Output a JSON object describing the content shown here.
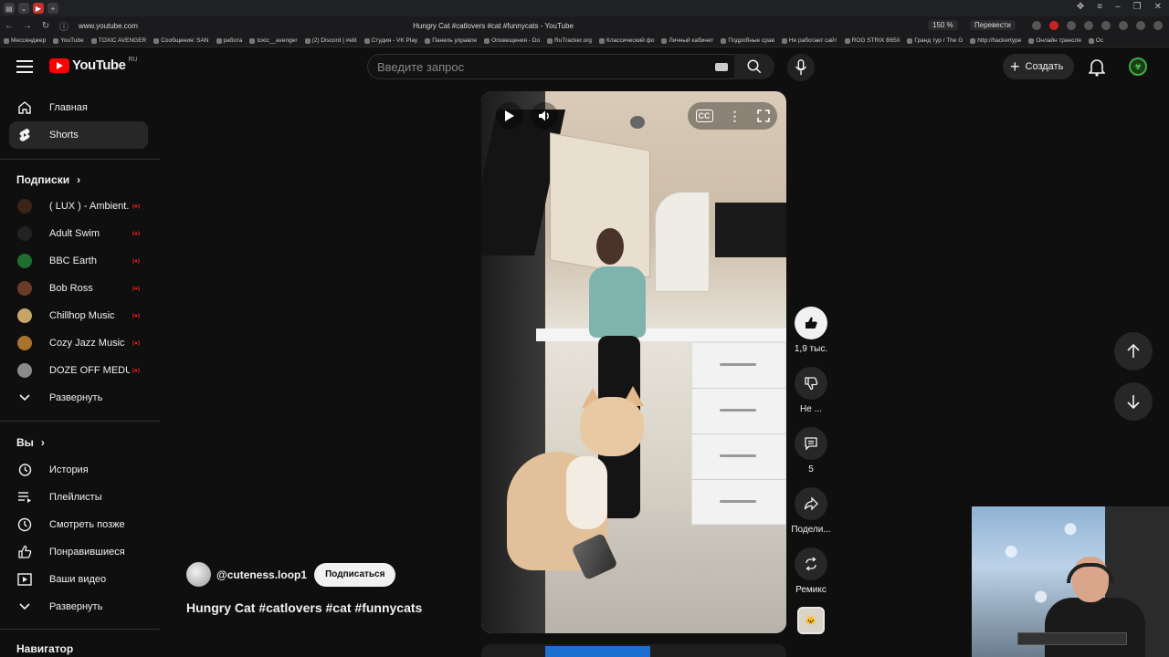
{
  "browser": {
    "url": "www.youtube.com",
    "tab_title": "Hungry Cat #catlovers #cat #funnycats - YouTube",
    "zoom": "150 %",
    "translate": "Перевести",
    "bookmarks": [
      "Мессенджер",
      "YouTube",
      "TOXIC AVENGER",
      "Сообщения: SAN",
      "работа",
      "toxic__avenger",
      "(2) Discord | #elit",
      "Студия - VK Play",
      "Панель управле",
      "Оповещения - Do",
      "RuTracker.org",
      "Классический фо",
      "Личный кабинет",
      "Подробные срав",
      "Не работает сайт",
      "ROG STRIX B650",
      "Гранд тур / The G",
      "http://hackertype",
      "Онлайн трансля",
      "Ос"
    ]
  },
  "masthead": {
    "logo_text": "YouTube",
    "country_code": "RU",
    "search_placeholder": "Введите запрос",
    "create_label": "Создать"
  },
  "sidebar": {
    "main": [
      {
        "label": "Главная",
        "icon": "home-icon"
      },
      {
        "label": "Shorts",
        "icon": "shorts-icon"
      }
    ],
    "subscriptions_title": "Подписки",
    "subscriptions": [
      {
        "label": "( LUX ) - Ambient...",
        "color": "#3a2417"
      },
      {
        "label": "Adult Swim",
        "color": "#222222"
      },
      {
        "label": "BBC Earth",
        "color": "#1f6e2f"
      },
      {
        "label": "Bob Ross",
        "color": "#6b3b2a"
      },
      {
        "label": "Chillhop Music",
        "color": "#c9a469"
      },
      {
        "label": "Cozy Jazz Music",
        "color": "#a8742c"
      },
      {
        "label": "DOZE OFF MEDU...",
        "color": "#8a8a8a"
      }
    ],
    "expand_label": "Развернуть",
    "you_title": "Вы",
    "you_items": [
      {
        "label": "История",
        "icon": "history-icon"
      },
      {
        "label": "Плейлисты",
        "icon": "playlists-icon"
      },
      {
        "label": "Смотреть позже",
        "icon": "watch-later-icon"
      },
      {
        "label": "Понравившиеся",
        "icon": "liked-icon"
      },
      {
        "label": "Ваши видео",
        "icon": "your-videos-icon"
      }
    ],
    "expand_label_2": "Развернуть",
    "navigator_title": "Навигатор"
  },
  "short": {
    "channel": "@cuteness.loop1",
    "subscribe_label": "Подписаться",
    "title": "Hungry Cat #catlovers  #cat #funnycats",
    "likes": "1,9 тыс.",
    "dislike_label": "Не ...",
    "comments": "5",
    "share_label": "Подели...",
    "remix_label": "Ремикс"
  },
  "colors": {
    "background": "#0f0f0f",
    "accent_red": "#ff0000",
    "live_red": "#e62117",
    "button_bg": "#272727"
  }
}
